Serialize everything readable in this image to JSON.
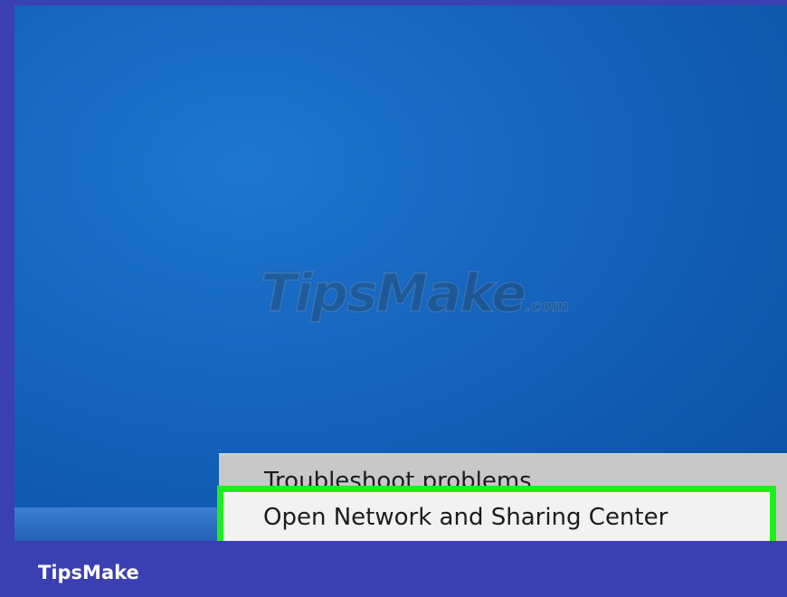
{
  "watermark": {
    "main": "TipsMake",
    "suffix": ".com"
  },
  "context_menu": {
    "items": [
      {
        "label": "Troubleshoot problems",
        "highlighted": false
      },
      {
        "label": "Open Network and Sharing Center",
        "highlighted": true
      }
    ]
  },
  "footer": {
    "brand": "TipsMake"
  },
  "colors": {
    "desktop": "#1463bd",
    "taskbar": "#2d6cc0",
    "menu_background": "#c8c8c8",
    "highlight_border": "#1cef1c",
    "footer_band": "#3a3fb1"
  }
}
